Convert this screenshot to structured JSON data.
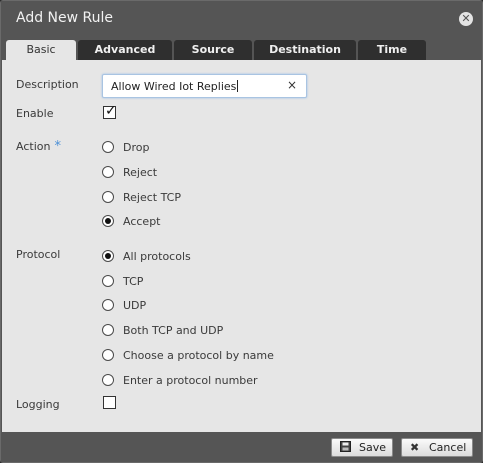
{
  "dialog": {
    "title": "Add New Rule",
    "close_icon": "close-icon"
  },
  "tabs": [
    {
      "label": "Basic",
      "active": true
    },
    {
      "label": "Advanced",
      "active": false
    },
    {
      "label": "Source",
      "active": false
    },
    {
      "label": "Destination",
      "active": false
    },
    {
      "label": "Time",
      "active": false
    }
  ],
  "form": {
    "description": {
      "label": "Description",
      "value": "Allow Wired Iot Replies",
      "clear_glyph": "×"
    },
    "enable": {
      "label": "Enable",
      "checked": true,
      "check_glyph": "✓"
    },
    "action": {
      "label": "Action",
      "required_mark": "*",
      "options": [
        "Drop",
        "Reject",
        "Reject TCP",
        "Accept"
      ],
      "selected": "Accept"
    },
    "protocol": {
      "label": "Protocol",
      "options": [
        "All protocols",
        "TCP",
        "UDP",
        "Both TCP and UDP",
        "Choose a protocol by name",
        "Enter a protocol number"
      ],
      "selected": "All protocols"
    },
    "logging": {
      "label": "Logging",
      "checked": false
    }
  },
  "footer": {
    "save_label": "Save",
    "save_icon": "save-icon",
    "cancel_label": "Cancel",
    "cancel_icon": "cancel-icon"
  },
  "colors": {
    "chrome": "#555555",
    "panel": "#e6e6e6",
    "tab_inactive": "#2f2f2f",
    "required_accent": "#4a8fd6"
  }
}
